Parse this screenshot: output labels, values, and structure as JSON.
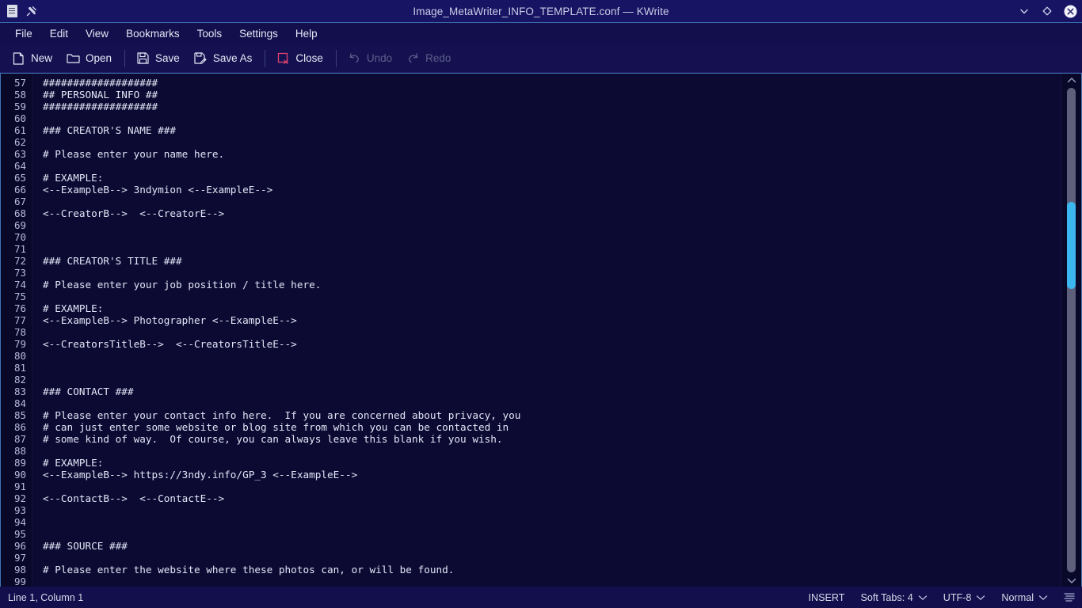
{
  "window": {
    "title": "Image_MetaWriter_INFO_TEMPLATE.conf — KWrite",
    "app_icon": "document-icon",
    "pin_icon": "pin-icon",
    "controls": [
      {
        "name": "minimize",
        "icon": "chevron-down-icon"
      },
      {
        "name": "maximize",
        "icon": "diamond-icon"
      },
      {
        "name": "close",
        "icon": "close-circle-icon"
      }
    ]
  },
  "menubar": {
    "items": [
      {
        "label": "File"
      },
      {
        "label": "Edit"
      },
      {
        "label": "View"
      },
      {
        "label": "Bookmarks"
      },
      {
        "label": "Tools"
      },
      {
        "label": "Settings"
      },
      {
        "label": "Help"
      }
    ]
  },
  "toolbar": {
    "buttons": [
      {
        "label": "New",
        "icon": "new-document-icon",
        "enabled": true
      },
      {
        "label": "Open",
        "icon": "folder-open-icon",
        "enabled": true
      },
      {
        "label": "Save",
        "icon": "floppy-disk-icon",
        "enabled": true
      },
      {
        "label": "Save As",
        "icon": "save-as-icon",
        "enabled": true
      },
      {
        "label": "Close",
        "icon": "close-document-icon",
        "enabled": true
      },
      {
        "label": "Undo",
        "icon": "undo-arrow-icon",
        "enabled": false
      },
      {
        "label": "Redo",
        "icon": "redo-arrow-icon",
        "enabled": false
      }
    ]
  },
  "editor": {
    "first_line_number": 57,
    "lines": [
      {
        "n": 57,
        "text": "###################"
      },
      {
        "n": 58,
        "text": "## PERSONAL INFO ##"
      },
      {
        "n": 59,
        "text": "###################"
      },
      {
        "n": 60,
        "text": ""
      },
      {
        "n": 61,
        "text": "### CREATOR'S NAME ###"
      },
      {
        "n": 62,
        "text": ""
      },
      {
        "n": 63,
        "text": "# Please enter your name here."
      },
      {
        "n": 64,
        "text": ""
      },
      {
        "n": 65,
        "text": "# EXAMPLE:"
      },
      {
        "n": 66,
        "text": "<--ExampleB--> 3ndymion <--ExampleE-->"
      },
      {
        "n": 67,
        "text": ""
      },
      {
        "n": 68,
        "text": "<--CreatorB-->  <--CreatorE-->"
      },
      {
        "n": 69,
        "text": ""
      },
      {
        "n": 70,
        "text": ""
      },
      {
        "n": 71,
        "text": ""
      },
      {
        "n": 72,
        "text": "### CREATOR'S TITLE ###"
      },
      {
        "n": 73,
        "text": ""
      },
      {
        "n": 74,
        "text": "# Please enter your job position / title here."
      },
      {
        "n": 75,
        "text": ""
      },
      {
        "n": 76,
        "text": "# EXAMPLE:"
      },
      {
        "n": 77,
        "text": "<--ExampleB--> Photographer <--ExampleE-->"
      },
      {
        "n": 78,
        "text": ""
      },
      {
        "n": 79,
        "text": "<--CreatorsTitleB-->  <--CreatorsTitleE-->"
      },
      {
        "n": 80,
        "text": ""
      },
      {
        "n": 81,
        "text": ""
      },
      {
        "n": 82,
        "text": ""
      },
      {
        "n": 83,
        "text": "### CONTACT ###"
      },
      {
        "n": 84,
        "text": ""
      },
      {
        "n": 85,
        "text": "# Please enter your contact info here.  If you are concerned about privacy, you"
      },
      {
        "n": 86,
        "text": "# can just enter some website or blog site from which you can be contacted in"
      },
      {
        "n": 87,
        "text": "# some kind of way.  Of course, you can always leave this blank if you wish."
      },
      {
        "n": 88,
        "text": ""
      },
      {
        "n": 89,
        "text": "# EXAMPLE:"
      },
      {
        "n": 90,
        "text": "<--ExampleB--> https://3ndy.info/GP_3 <--ExampleE-->"
      },
      {
        "n": 91,
        "text": ""
      },
      {
        "n": 92,
        "text": "<--ContactB-->  <--ContactE-->"
      },
      {
        "n": 93,
        "text": ""
      },
      {
        "n": 94,
        "text": ""
      },
      {
        "n": 95,
        "text": ""
      },
      {
        "n": 96,
        "text": "### SOURCE ###"
      },
      {
        "n": 97,
        "text": ""
      },
      {
        "n": 98,
        "text": "# Please enter the website where these photos can, or will be found."
      },
      {
        "n": 99,
        "text": ""
      }
    ],
    "scrollbar": {
      "thumb_top_pct": 23.5,
      "thumb_height_pct": 18,
      "up_arrow_icon": "chevron-up-icon",
      "down_arrow_icon": "chevron-down-icon"
    }
  },
  "statusbar": {
    "cursor_position": "Line 1, Column 1",
    "insert_mode": "INSERT",
    "soft_tabs": "Soft Tabs: 4",
    "encoding": "UTF-8",
    "highlight_mode": "Normal",
    "lines_icon": "text-lines-icon"
  },
  "colors": {
    "titlebar_bg": "#171463",
    "menubar_bg": "#120f4c",
    "toolbar_bg": "#151150",
    "editor_bg": "#0c0a33",
    "gutter_bg": "#0a0829",
    "text_fg": "#e2e5f6",
    "scrollbar_thumb": "#3cb6ef",
    "accent_border": "#3e74b6",
    "close_icon_red": "#e0436f"
  }
}
